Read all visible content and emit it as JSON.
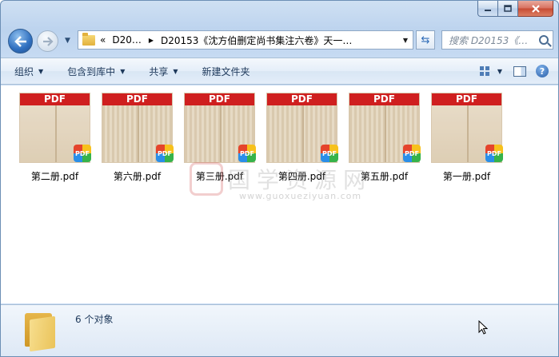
{
  "window": {
    "caption_buttons": [
      "minimize-icon",
      "maximize-icon",
      "close-icon"
    ]
  },
  "nav": {
    "breadcrumb": {
      "lead": "«",
      "first": "D20…",
      "current": "D20153《沈方伯删定尚书集注六卷》天一…"
    },
    "search_placeholder": "搜索 D20153《…"
  },
  "toolbar": {
    "organize": "组织",
    "include_in_library": "包含到库中",
    "share": "共享",
    "new_folder": "新建文件夹"
  },
  "files": [
    {
      "name": "第二册.pdf",
      "badge": "PDF",
      "thumb_style": "plain"
    },
    {
      "name": "第六册.pdf",
      "badge": "PDF",
      "thumb_style": "text"
    },
    {
      "name": "第三册.pdf",
      "badge": "PDF",
      "thumb_style": "text"
    },
    {
      "name": "第四册.pdf",
      "badge": "PDF",
      "thumb_style": "text"
    },
    {
      "name": "第五册.pdf",
      "badge": "PDF",
      "thumb_style": "text"
    },
    {
      "name": "第一册.pdf",
      "badge": "PDF",
      "thumb_style": "plain"
    }
  ],
  "watermark": {
    "text": "国学资源网",
    "url": "www.guoxueziyuan.com"
  },
  "status": {
    "count": "6 个对象"
  },
  "colors": {
    "pdf_banner": "#cf1f1f",
    "chrome": "#c6daf2"
  }
}
